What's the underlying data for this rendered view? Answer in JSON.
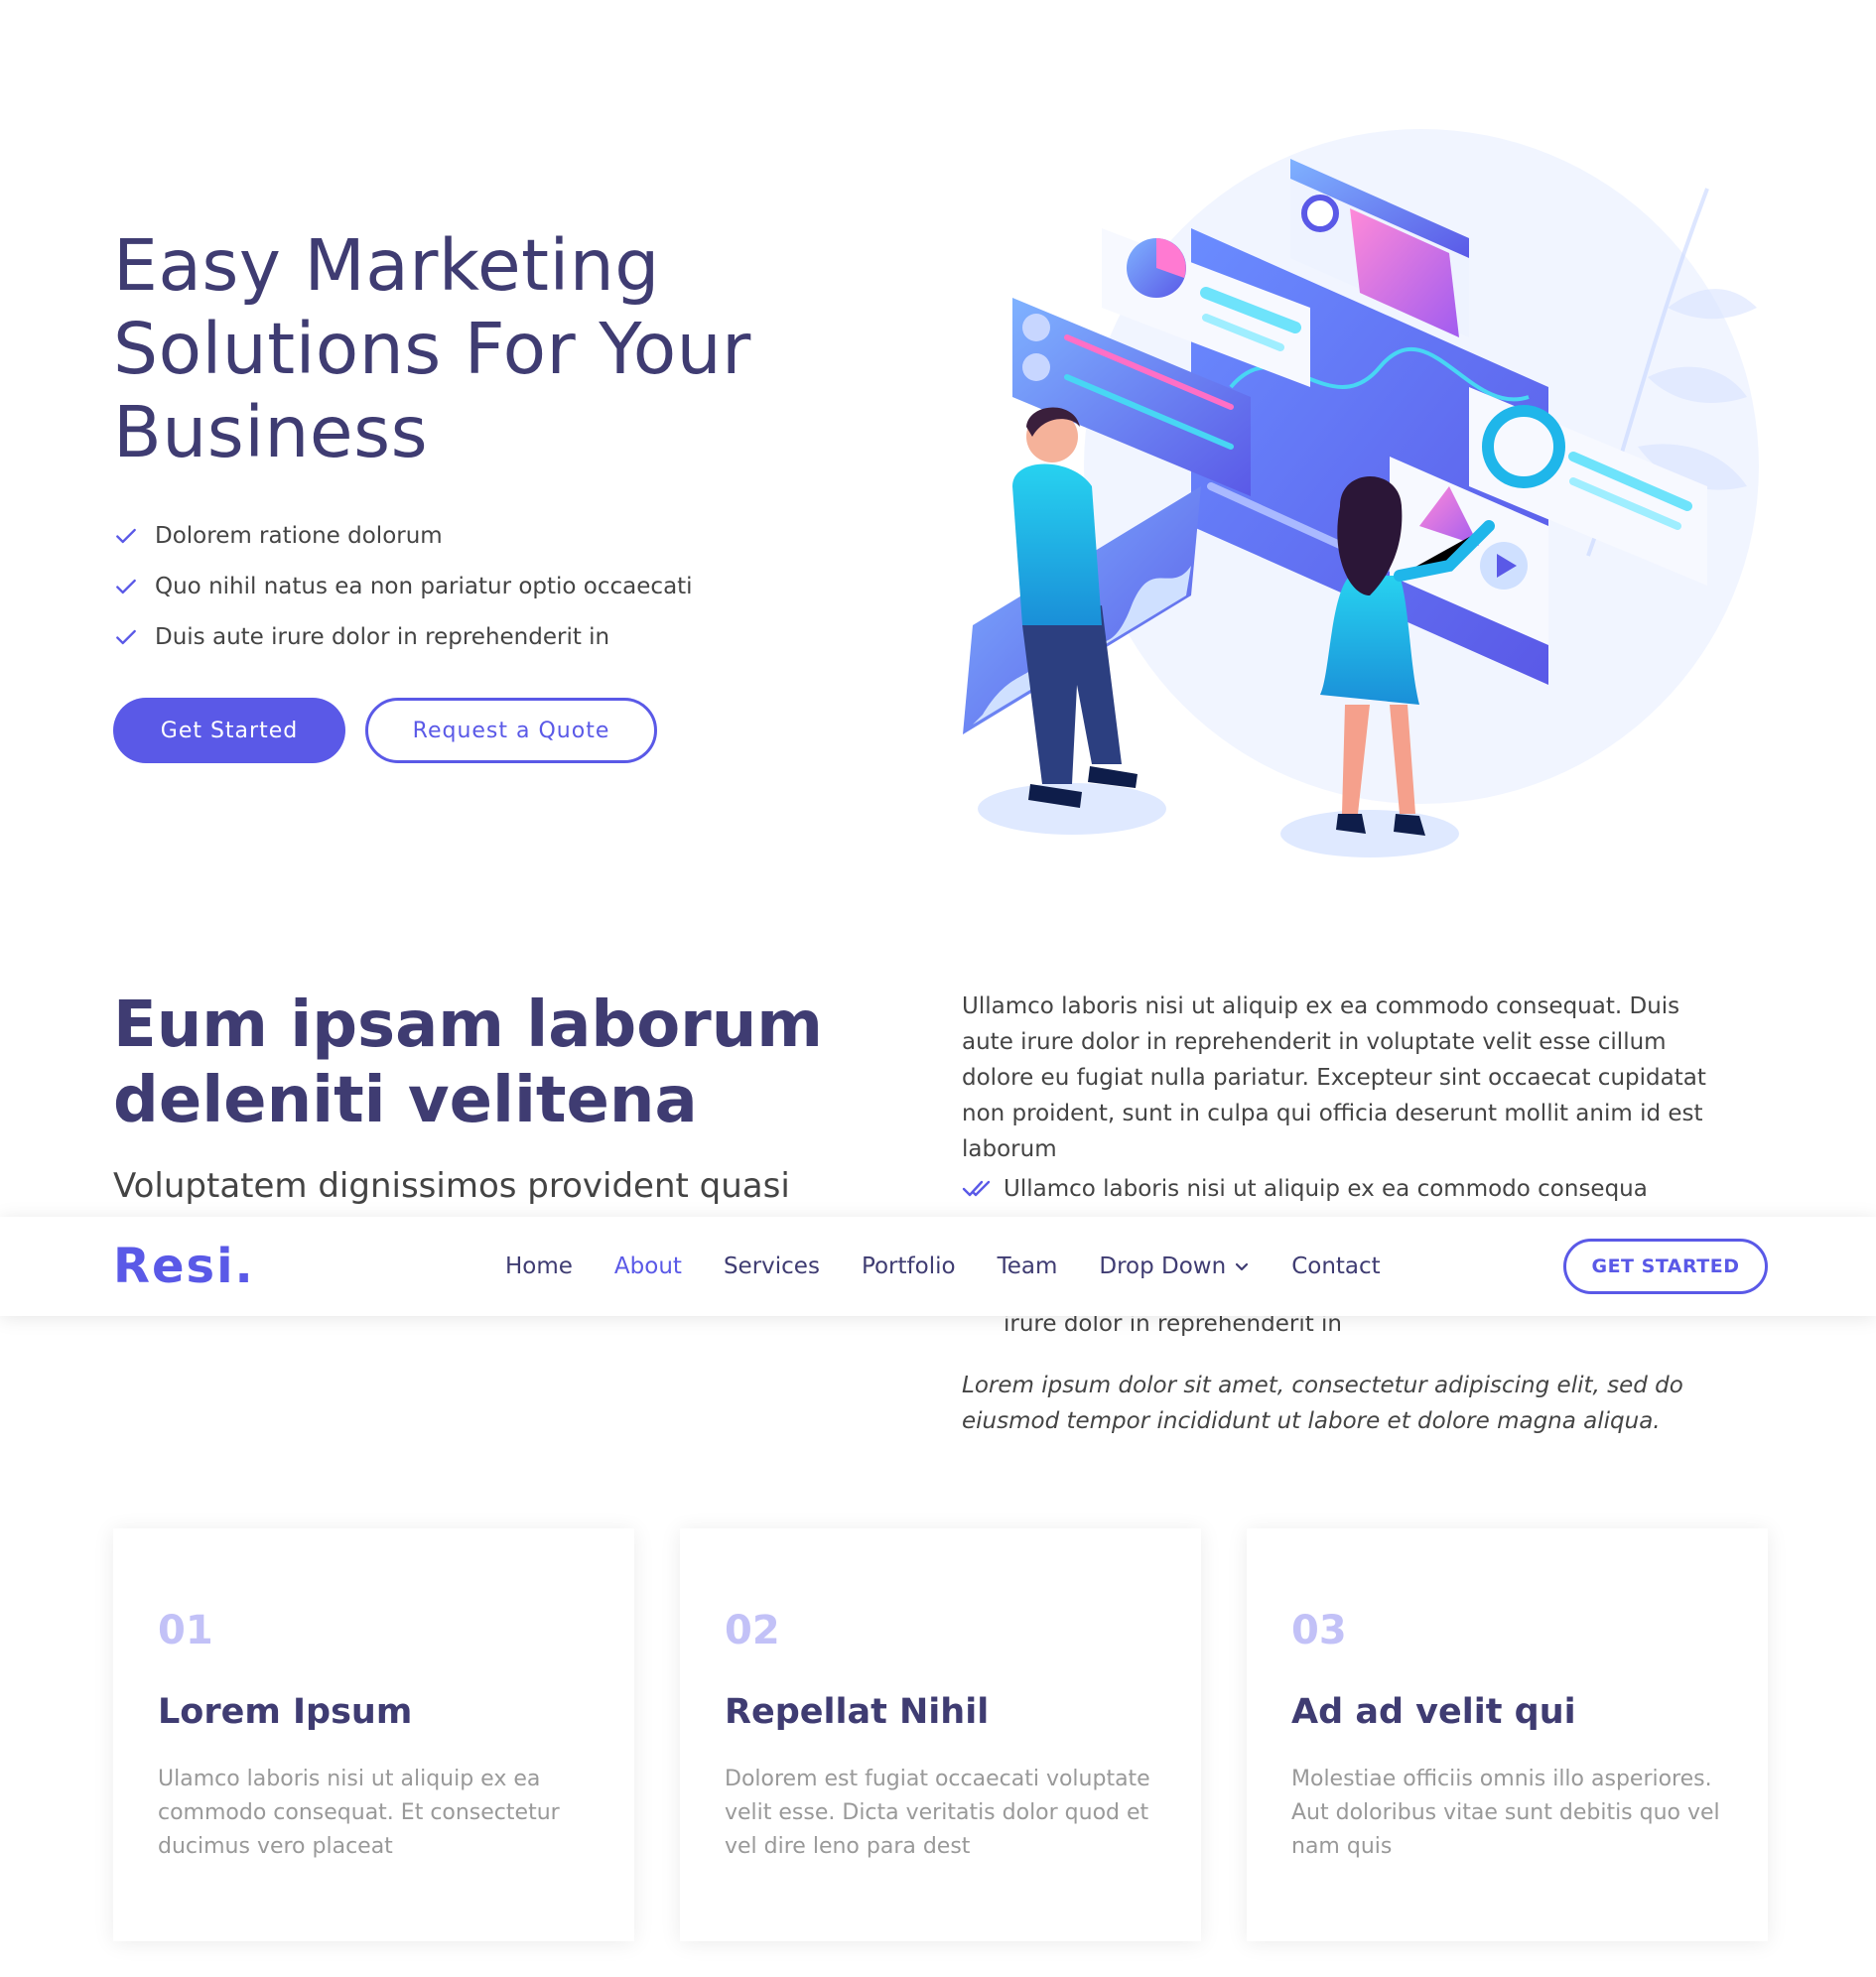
{
  "hero": {
    "title": "Easy Marketing Solutions For Your Business",
    "checklist": [
      "Dolorem ratione dolorum",
      "Quo nihil natus ea non pariatur optio occaecati",
      "Duis aute irure dolor in reprehenderit in"
    ],
    "primary_button": "Get Started",
    "secondary_button": "Request a Quote",
    "illustration_icon": "marketing-illustration"
  },
  "about": {
    "title": "Eum ipsam laborum deleniti velitena",
    "subtitle": "Voluptatem dignissimos provident quasi",
    "paragraph": "Ullamco laboris nisi ut aliquip ex ea commodo consequat. Duis aute irure dolor in reprehenderit in voluptate velit esse cillum dolore eu fugiat nulla pariatur. Excepteur sint occaecat cupidatat non proident, sunt in culpa qui officia deserunt mollit anim id est laborum",
    "list": [
      "Ullamco laboris nisi ut aliquip ex ea commodo consequa",
      "irure dolor in reprehenderit in"
    ],
    "italic_text": "Lorem ipsum dolor sit amet, consectetur adipiscing elit, sed do eiusmod tempor incididunt ut labore et dolore magna aliqua."
  },
  "header": {
    "logo": "Resi.",
    "nav": [
      {
        "label": "Home",
        "active": false
      },
      {
        "label": "About",
        "active": true
      },
      {
        "label": "Services",
        "active": false
      },
      {
        "label": "Portfolio",
        "active": false
      },
      {
        "label": "Team",
        "active": false
      },
      {
        "label": "Drop Down",
        "active": false
      },
      {
        "label": "Contact",
        "active": false
      }
    ],
    "cta": "GET STARTED"
  },
  "cards": [
    {
      "number": "01",
      "title": "Lorem Ipsum",
      "text": "Ulamco laboris nisi ut aliquip ex ea commodo consequat. Et consectetur ducimus vero placeat"
    },
    {
      "number": "02",
      "title": "Repellat Nihil",
      "text": "Dolorem est fugiat occaecati voluptate velit esse. Dicta veritatis dolor quod et vel dire leno para dest"
    },
    {
      "number": "03",
      "title": "Ad ad velit qui",
      "text": "Molestiae officiis omnis illo asperiores. Aut doloribus vitae sunt debitis quo vel nam quis"
    }
  ],
  "colors": {
    "accent": "#5a59e7",
    "heading": "#3f3c72",
    "body_text": "#444444",
    "muted_text": "#999999",
    "card_number": "#c2c1f7"
  }
}
